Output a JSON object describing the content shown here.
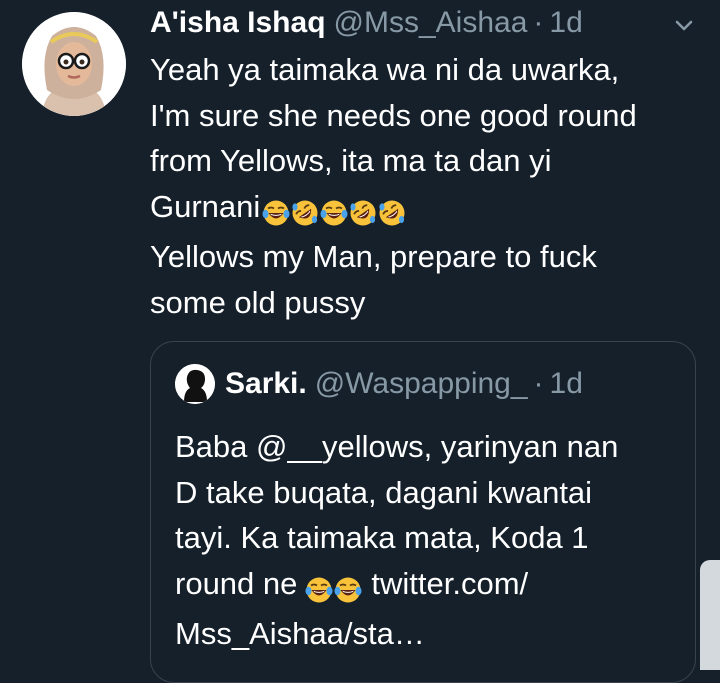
{
  "tweet": {
    "author_name": "A'isha Ishaq",
    "author_handle": "@Mss_Aishaa",
    "separator": "·",
    "time": "1d",
    "lines": [
      "Yeah ya taimaka wa ni da uwarka,",
      "I'm sure she needs one good round",
      "from Yellows, ita ma ta dan yi",
      "Gurnani",
      "Yellows my Man, prepare to fuck",
      "some old pussy"
    ],
    "emoji_icons": [
      "tears-of-joy-icon",
      "rofl-icon",
      "tears-of-joy-icon",
      "rofl-icon",
      "rofl-icon"
    ]
  },
  "quoted_tweet": {
    "author_name": "Sarki.",
    "author_handle": "@Waspapping_",
    "separator": "·",
    "time": "1d",
    "lines": [
      "Baba @__yellows, yarinyan nan",
      "D take buqata, dagani kwantai",
      "tayi. Ka taimaka mata, Koda 1",
      "round ne",
      "twitter.com/",
      "Mss_Aishaa/sta…"
    ],
    "emoji_icons": [
      "tears-of-joy-icon",
      "tears-of-joy-icon"
    ]
  },
  "colors": {
    "background": "#15202b",
    "text_primary": "#ffffff",
    "text_secondary": "#8899a6",
    "border": "#38444d"
  }
}
